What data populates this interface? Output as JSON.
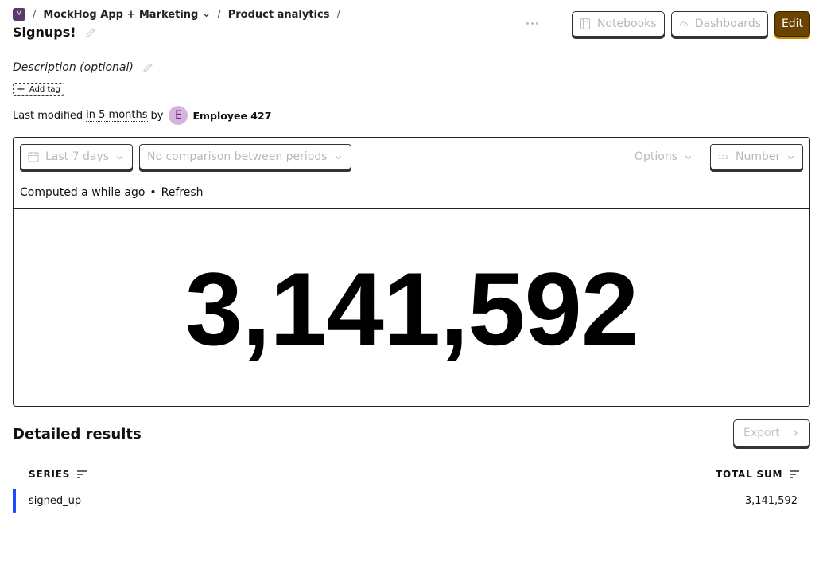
{
  "breadcrumb": {
    "logo_letter": "M",
    "separator": "/",
    "project": "MockHog App + Marketing",
    "section": "Product analytics"
  },
  "insight": {
    "title": "Signups!",
    "description_placeholder": "Description (optional)",
    "add_tag_label": "Add tag"
  },
  "modified": {
    "prefix": "Last modified",
    "when": "in 5 months",
    "by": "by",
    "avatar_letter": "E",
    "user": "Employee 427"
  },
  "header_actions": {
    "notebooks_label": "Notebooks",
    "dashboards_label": "Dashboards",
    "edit_label": "Edit"
  },
  "toolbar": {
    "date_range": "Last 7 days",
    "comparison": "No comparison between periods",
    "options": "Options",
    "display_type": "Number"
  },
  "status": {
    "computed": "Computed a while ago",
    "bullet": "•",
    "refresh": "Refresh"
  },
  "big_number": "3,141,592",
  "details": {
    "heading": "Detailed results",
    "export_label": "Export",
    "columns": {
      "series": "SERIES",
      "total": "TOTAL SUM"
    },
    "rows": [
      {
        "series": "signed_up",
        "total": "3,141,592"
      }
    ]
  },
  "colors": {
    "edit_button_bg": "#6b4300",
    "series_color": "#1d4aff",
    "avatar_bg": "#d7b3df",
    "logo_bg": "#5b3a6b"
  },
  "icons": {
    "notebook": "notebook-icon",
    "dashboard": "dashboard-icon",
    "calendar": "calendar-icon",
    "number": "number-icon",
    "pencil": "pencil-icon",
    "sort": "sort-icon",
    "more": "more-icon"
  }
}
